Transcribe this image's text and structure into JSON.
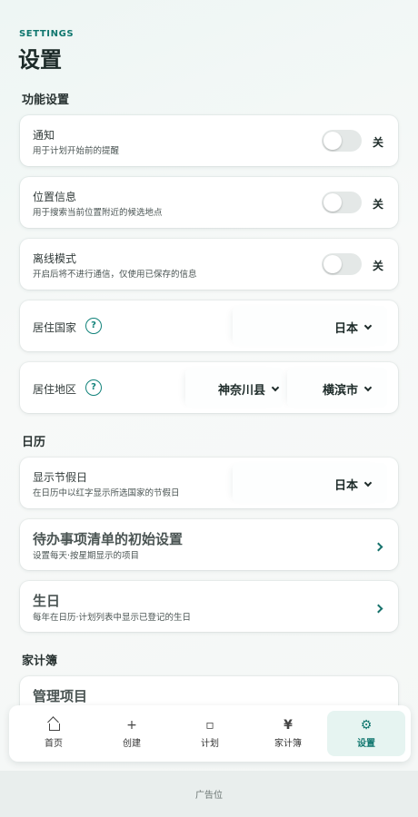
{
  "header": {
    "eyebrow": "SETTINGS",
    "title": "设置"
  },
  "sections": {
    "features": "功能设置",
    "calendar": "日历",
    "household": "家计簿"
  },
  "notification": {
    "title": "通知",
    "sub": "用于计划开始前的提醒",
    "state": "关"
  },
  "location": {
    "title": "位置信息",
    "sub": "用于搜索当前位置附近的候选地点",
    "state": "关"
  },
  "offline": {
    "title": "离线模式",
    "sub": "开启后将不进行通信，仅使用已保存的信息",
    "state": "关"
  },
  "country": {
    "title": "居住国家",
    "help": "?",
    "value": "日本"
  },
  "region": {
    "title": "居住地区",
    "help": "?",
    "prefecture": "神奈川县",
    "city": "横滨市"
  },
  "holidays": {
    "title": "显示节假日",
    "sub": "在日历中以红字显示所选国家的节假日",
    "value": "日本"
  },
  "todo_init": {
    "title": "待办事项清单的初始设置",
    "sub": "设置每天·按星期显示的项目"
  },
  "birthday": {
    "title": "生日",
    "sub": "每年在日历·计划列表中显示已登记的生日"
  },
  "manage_items": {
    "title": "管理项目"
  },
  "nav": {
    "home": "首页",
    "create": "创建",
    "plan": "计划",
    "household": "家计簿",
    "settings": "设置",
    "create_icon": "+",
    "plan_icon": "▫",
    "household_icon": "¥",
    "settings_icon": "⚙"
  },
  "ad": {
    "label": "广告位"
  },
  "colors": {
    "accent": "#0f766e",
    "toggle_off": "#e4e8e7",
    "active_nav_bg": "#e6f4f1"
  }
}
